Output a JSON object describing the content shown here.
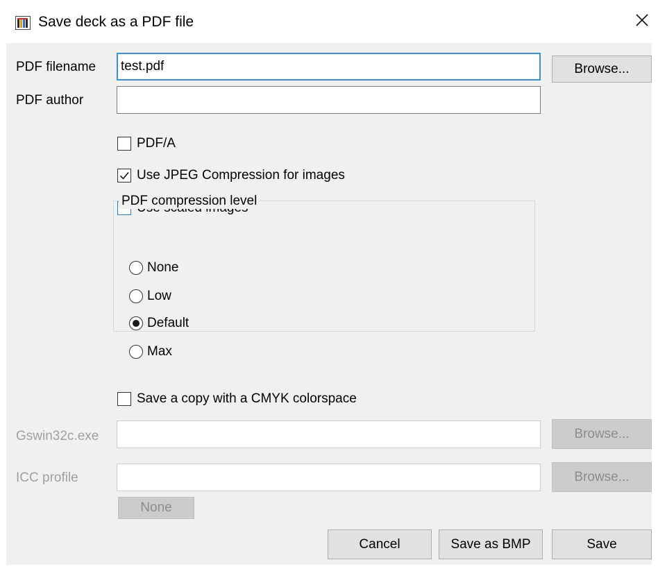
{
  "window": {
    "title": "Save deck as a PDF file"
  },
  "pdf_filename": {
    "label": "PDF filename",
    "value": "test.pdf",
    "browse_label": "Browse..."
  },
  "pdf_author": {
    "label": "PDF author",
    "value": ""
  },
  "options": {
    "pdfa": {
      "label": "PDF/A",
      "checked": false
    },
    "jpeg": {
      "label": "Use JPEG Compression for images",
      "checked": true
    },
    "scaled": {
      "label": "Use scaled images",
      "checked": false
    }
  },
  "compression": {
    "legend": "PDF compression level",
    "options": [
      {
        "label": "None",
        "selected": false
      },
      {
        "label": "Low",
        "selected": false
      },
      {
        "label": "Default",
        "selected": true
      },
      {
        "label": "Max",
        "selected": false
      }
    ]
  },
  "cmyk": {
    "label": "Save a copy with a CMYK colorspace",
    "checked": false
  },
  "gswin": {
    "label": "Gswin32c.exe",
    "value": "",
    "browse_label": "Browse..."
  },
  "icc": {
    "label": "ICC profile",
    "value": "",
    "browse_label": "Browse...",
    "none_label": "None"
  },
  "footer": {
    "cancel_label": "Cancel",
    "save_bmp_label": "Save as BMP",
    "save_label": "Save"
  },
  "colors": {
    "focus_border": "#3a8fd6",
    "dialog_bg": "#f0f0f0",
    "disabled_text": "#a0a0a0"
  },
  "icons": {
    "app": "app-icon",
    "close": "close-icon",
    "check": "checkmark-icon"
  }
}
